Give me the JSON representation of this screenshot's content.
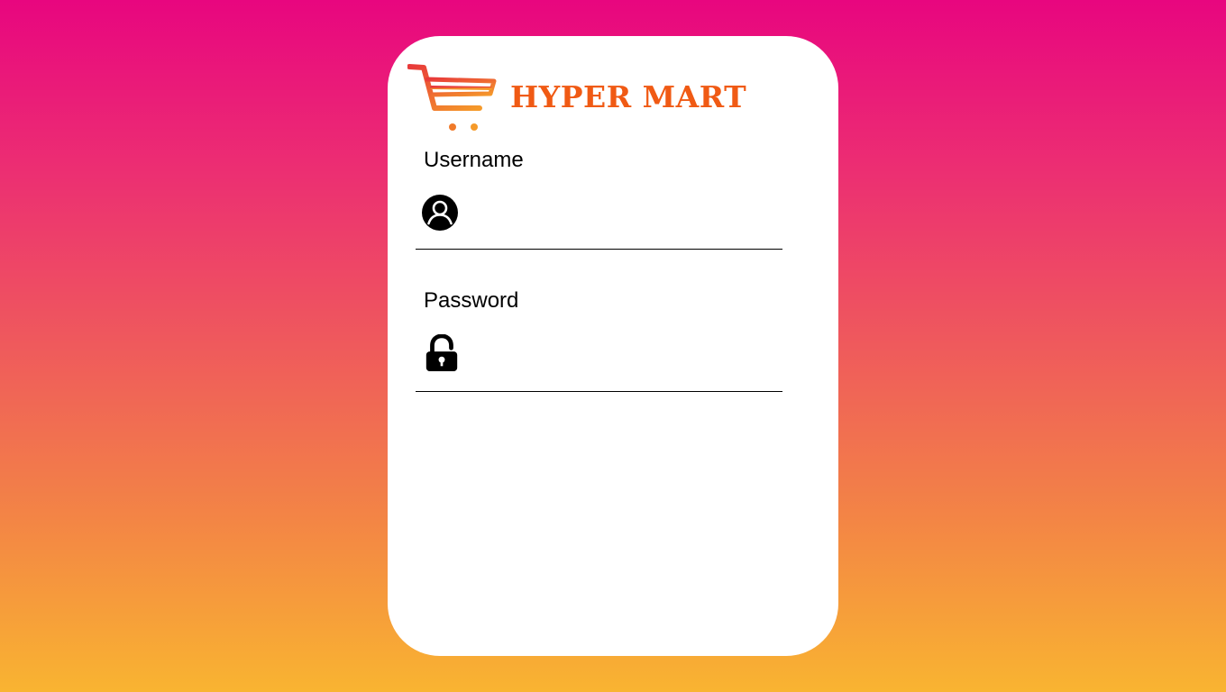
{
  "brand": {
    "name": "HYPER MART",
    "logo_icon": "shopping-cart-icon",
    "color": "#f05a14"
  },
  "login_form": {
    "username": {
      "label": "Username",
      "icon": "user-icon",
      "value": "",
      "placeholder": ""
    },
    "password": {
      "label": "Password",
      "icon": "lock-icon",
      "value": "",
      "placeholder": ""
    }
  },
  "colors": {
    "gradient_top": "#e8067f",
    "gradient_bottom": "#f9b431",
    "card": "#ffffff"
  }
}
